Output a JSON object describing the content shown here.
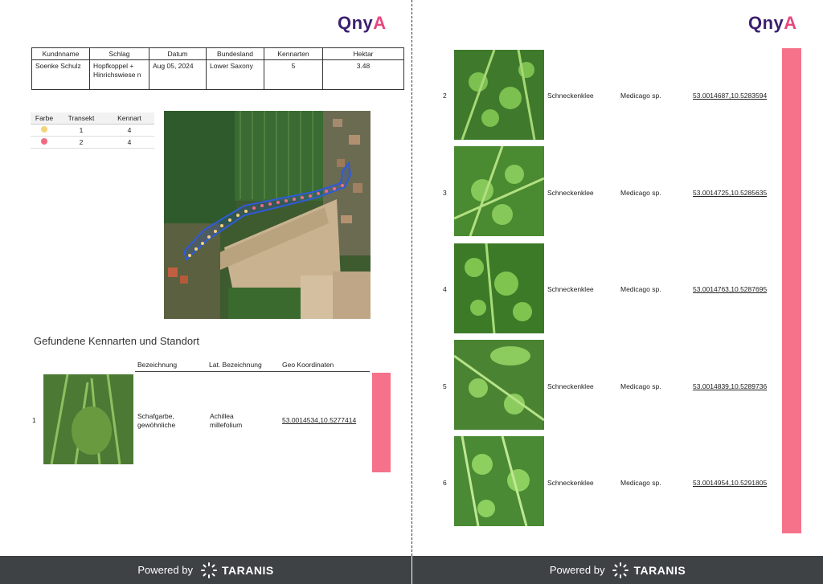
{
  "logo": {
    "part1": "Qny",
    "part2": "A"
  },
  "header_table": {
    "columns": [
      "Kundnname",
      "Schlag",
      "Datum",
      "Bundesland",
      "Kennarten",
      "Hektar"
    ],
    "values": [
      "Soenke Schulz",
      "Hopfkoppel + Hinrichswiese n",
      "Aug 05, 2024",
      "Lower Saxony",
      "5",
      "3.48"
    ]
  },
  "legend": {
    "columns": [
      "Farbe",
      "Transekt",
      "Kennart"
    ],
    "rows": [
      {
        "color": "#f5d37a",
        "transekt": "1",
        "kennart": "4"
      },
      {
        "color": "#f06b82",
        "transekt": "2",
        "kennart": "4"
      }
    ]
  },
  "section_title": "Gefundene Kennarten und Standort",
  "species_columns": [
    "Bezeichnung",
    "Lat. Bezeichnung",
    "Geo Koordinaten"
  ],
  "species": [
    {
      "num": "1",
      "name": "Schafgarbe, gewöhnliche",
      "latin": "Achillea millefolium",
      "geo": "53.0014534,10.5277414"
    },
    {
      "num": "2",
      "name": "Schneckenklee",
      "latin": "Medicago sp.",
      "geo": "53.0014687,10.5283594"
    },
    {
      "num": "3",
      "name": "Schneckenklee",
      "latin": "Medicago sp.",
      "geo": "53.0014725,10.5285635"
    },
    {
      "num": "4",
      "name": "Schneckenklee",
      "latin": "Medicago sp.",
      "geo": "53.0014763,10.5287695"
    },
    {
      "num": "5",
      "name": "Schneckenklee",
      "latin": "Medicago sp.",
      "geo": "53.0014839,10.5289736"
    },
    {
      "num": "6",
      "name": "Schneckenklee",
      "latin": "Medicago sp.",
      "geo": "53.0014954,10.5291805"
    }
  ],
  "footer": {
    "powered_by": "Powered by",
    "brand": "TARANIS"
  },
  "colors": {
    "pink": "#f5728a",
    "footer_bg": "#3f4244",
    "logo_purple": "#3b1f6e",
    "logo_pink": "#e8467c"
  }
}
